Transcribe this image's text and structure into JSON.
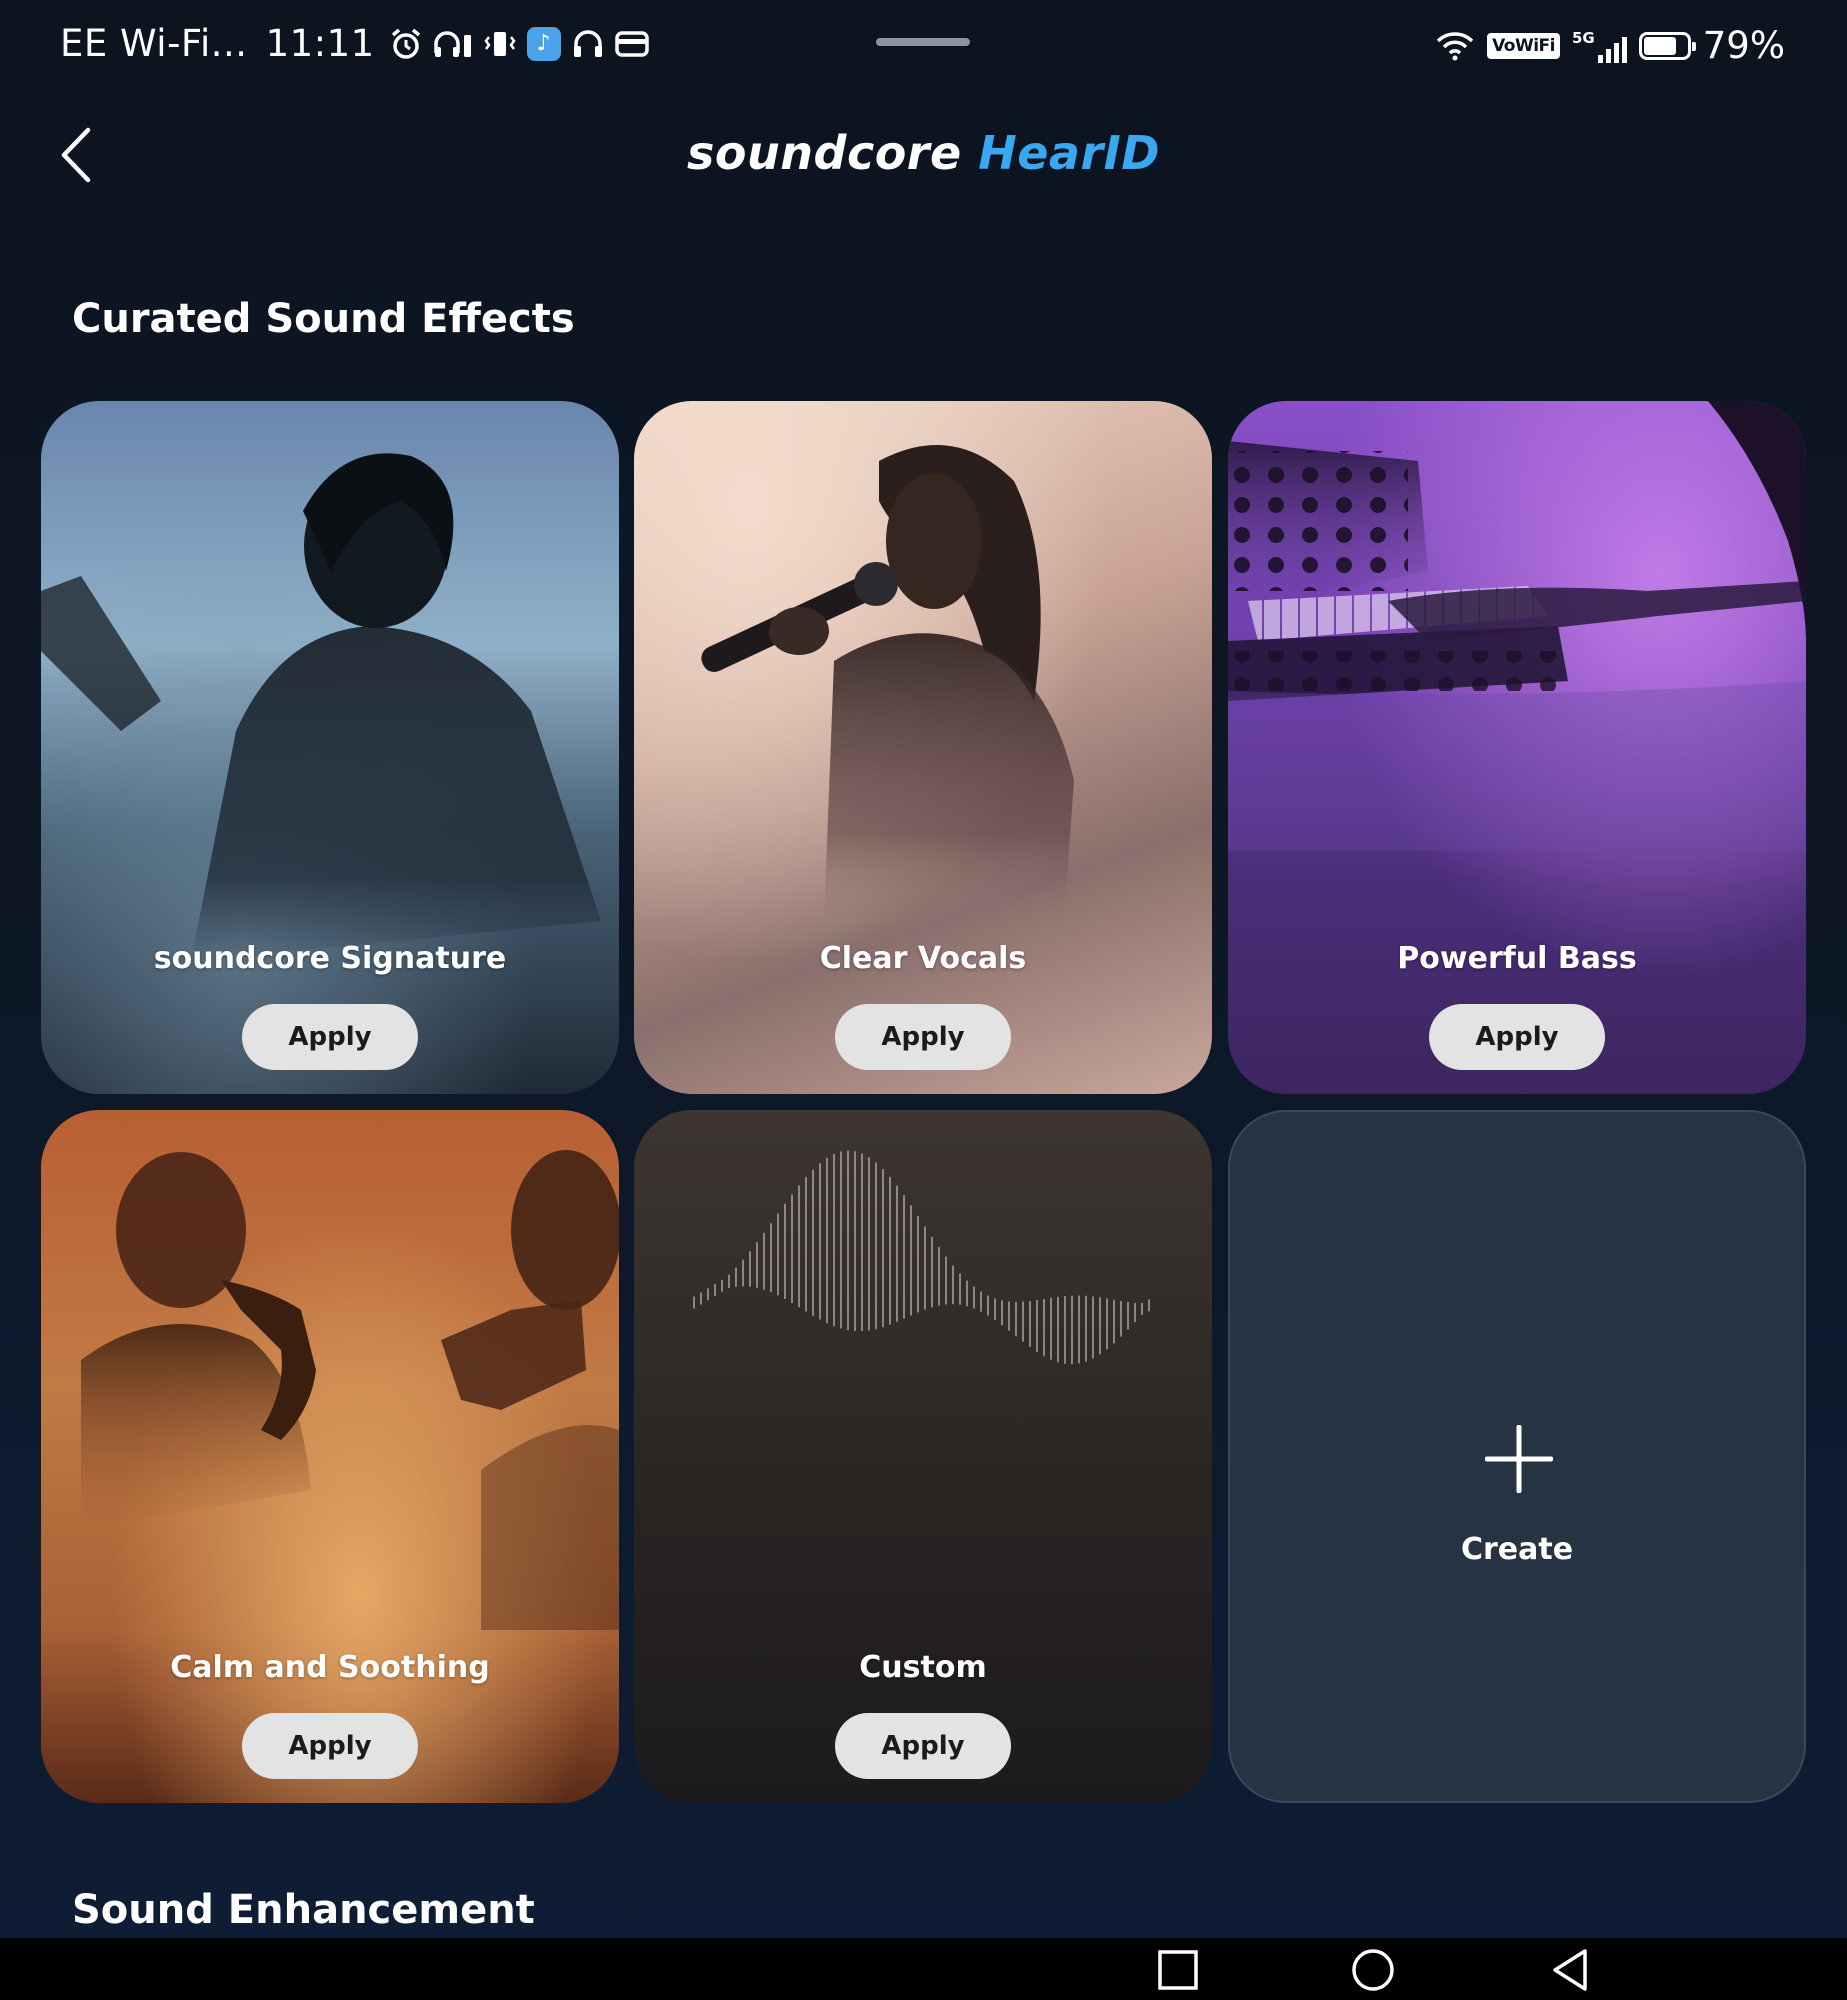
{
  "status_bar": {
    "carrier": "EE Wi-Fi...",
    "time": "11:11",
    "icons": [
      "alarm-icon",
      "headphones-battery-icon",
      "vibrate-icon",
      "music-app-icon",
      "headphones-icon",
      "wallet-icon"
    ],
    "right_icons": [
      "wifi-icon",
      "vowifi-icon",
      "5g-signal-icon",
      "battery-icon"
    ],
    "vowifi_label": "VoWiFi",
    "network_label": "5G",
    "battery_level": 0.79,
    "battery_percent": "79%"
  },
  "header": {
    "brand_main": "soundcore",
    "brand_accent": "HearID",
    "accent_color": "#3aa8f0"
  },
  "sections": {
    "curated_title": "Curated Sound Effects",
    "enhancement_title": "Sound Enhancement"
  },
  "cards": [
    {
      "label": "soundcore Signature",
      "button": "Apply",
      "art": "guitarist-silhouette"
    },
    {
      "label": "Clear Vocals",
      "button": "Apply",
      "art": "singer-with-microphone"
    },
    {
      "label": "Powerful Bass",
      "button": "Apply",
      "art": "synthesizer-player"
    },
    {
      "label": "Calm and Soothing",
      "button": "Apply",
      "art": "saxophone-trumpet-players"
    },
    {
      "label": "Custom",
      "button": "Apply",
      "art": "sound-waveform"
    }
  ],
  "create_card": {
    "label": "Create",
    "icon": "plus-icon"
  },
  "nav_bar": {
    "icons": [
      "recent-apps-icon",
      "home-icon",
      "back-icon"
    ]
  }
}
